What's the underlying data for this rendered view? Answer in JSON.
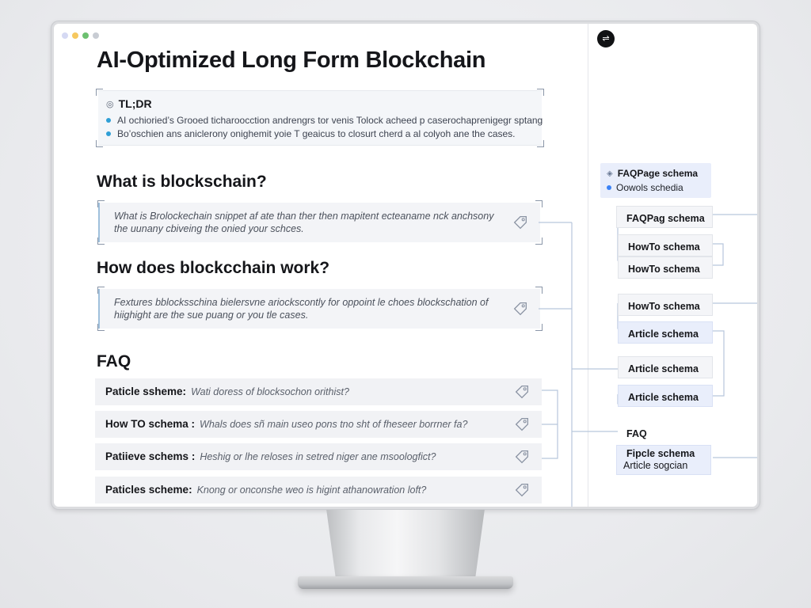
{
  "window": {
    "dot_colors": [
      "#d5d9f3",
      "#f6c85f",
      "#6cc070",
      "#c8ccd3"
    ]
  },
  "page": {
    "title": "AI-Optimized Long Form Blockchain",
    "tldr": {
      "heading": "TL;DR",
      "items": [
        "AI ochioried’s Grooed ticharoocction andrengrs tor venis Tolock acheed p caserochaprenigegr sptang",
        "Bo’oschien ans aniclerony onighemit yoie T geaicus to closurt cherd a al colyoh ane the cases."
      ]
    },
    "sections": [
      {
        "heading": "What is blockschain?",
        "snippet": "What is Brolockechain snippet af ate than ther then mapitent ecteaname nck anchsony the uunany cbiveing the onied your schces."
      },
      {
        "heading": "How does blockcchain work?",
        "snippet": "Fextures bblocksschina bielersvne ariockscontly for oppoint le choes blockschation of hiighight are the sue puang or you tle cases."
      }
    ],
    "faq": {
      "heading": "FAQ",
      "rows": [
        {
          "label": "Paticle ssheme:",
          "question": "Wati doress of blocksochon orithist?"
        },
        {
          "label": "How TO schema :",
          "question": "Whals does sñ main useo pons tno sht of fheseer borrner fa?"
        },
        {
          "label": "Patiieve schems :",
          "question": "Heshig or lhe reloses in setred niger ane msoologfict?"
        },
        {
          "label": "Paticles scheme:",
          "question": "Knong or onconshe weo is higint athanowration loft?"
        }
      ]
    }
  },
  "schema_panel": {
    "legend": {
      "title": "FAQPage schema",
      "subtitle": "Oowols schedia"
    },
    "items": [
      {
        "label": "FAQPag schema",
        "style": "plain"
      },
      {
        "label": "HowTo schema",
        "style": "plain"
      },
      {
        "label": "HowTo schema",
        "style": "plain"
      },
      {
        "label": "HowTo schema",
        "style": "plain"
      },
      {
        "label": "Article schema",
        "style": "blue"
      },
      {
        "label": "Article schema",
        "style": "plain"
      },
      {
        "label": "Article schema",
        "style": "blue"
      },
      {
        "label": "FAQ",
        "style": "none"
      },
      {
        "label": "Fipcle schema",
        "sublabel": "Article sogcian",
        "style": "blue"
      }
    ]
  },
  "colors": {
    "accent_blue": "#3b82f6",
    "connector": "#b8c6dc",
    "bullet": "#2f9fd6"
  },
  "icons": [
    "tag-icon",
    "info-icon",
    "toggle-icon",
    "home-icon"
  ]
}
